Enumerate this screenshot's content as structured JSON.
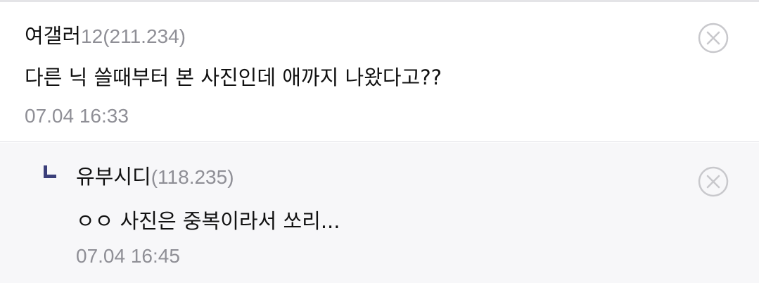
{
  "comments": [
    {
      "nickname": "여갤러",
      "id_suffix": "12",
      "ip": "(211.234)",
      "text": "다른 닉 쓸때부터 본 사진인데 애까지 나왔다고??",
      "timestamp": "07.04 16:33"
    }
  ],
  "replies": [
    {
      "nickname": "유부시디",
      "ip": "(118.235)",
      "text": "ㅇㅇ 사진은 중복이라서 쏘리...",
      "timestamp": "07.04 16:45"
    }
  ],
  "icons": {
    "delete": "delete-circle-x-icon",
    "reply_indicator": "reply-corner-icon"
  },
  "colors": {
    "meta_gray": "#8f8f96",
    "reply_bg": "#f7f7f9",
    "reply_mark": "#3b3f7a",
    "delete_icon": "#c8c8cc"
  }
}
